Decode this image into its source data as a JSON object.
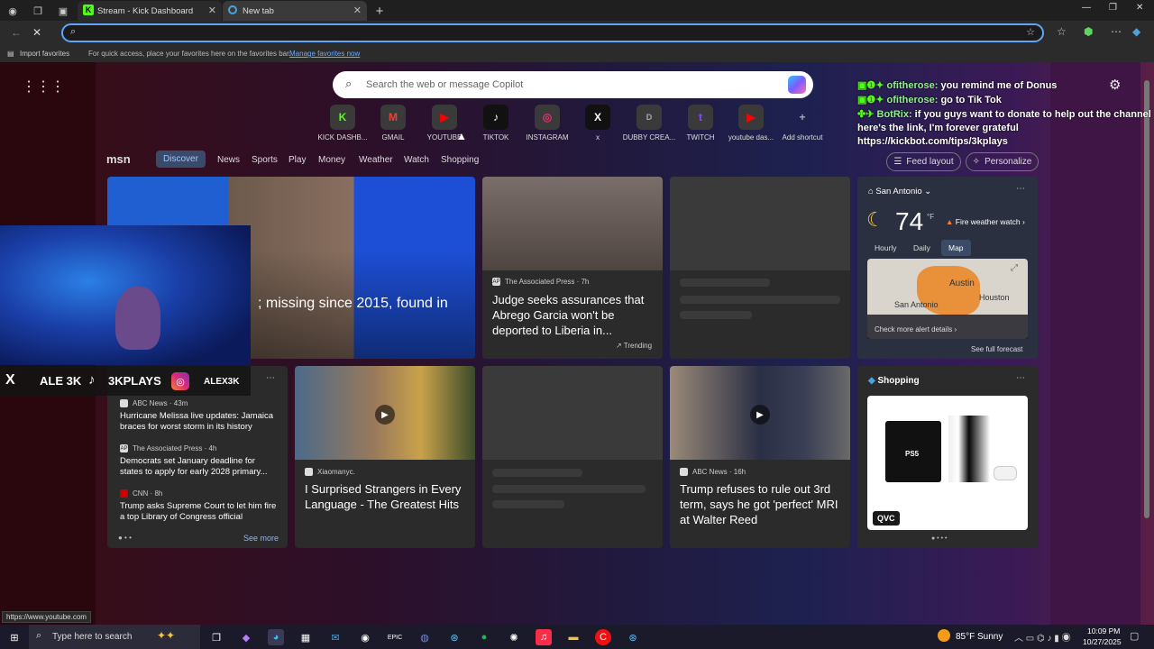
{
  "browser": {
    "tabs": [
      {
        "title": "Stream - Kick Dashboard",
        "favicon": "K"
      },
      {
        "title": "New tab"
      }
    ],
    "address_value": "",
    "favorites": {
      "import_label": "Import favorites",
      "hint": "For quick access, place your favorites here on the favorites bar.",
      "manage_link": "Manage favorites now"
    },
    "status_url": "https://www.youtube.com"
  },
  "newtab": {
    "search_placeholder": "Search the web or message Copilot",
    "shortcuts": [
      {
        "label": "KICK DASHB...",
        "glyph": "K",
        "color": "#53fc18"
      },
      {
        "label": "GMAIL",
        "glyph": "M",
        "color": "#ea4335"
      },
      {
        "label": "YOUTUBE",
        "glyph": "▶",
        "color": "#ff0000"
      },
      {
        "label": "TIKTOK",
        "glyph": "♪",
        "color": "#ffffff"
      },
      {
        "label": "INSTAGRAM",
        "glyph": "◎",
        "color": "#e1306c"
      },
      {
        "label": "x",
        "glyph": "X",
        "color": "#ffffff"
      },
      {
        "label": "DUBBY CREA...",
        "glyph": "D",
        "color": "#aaaaaa"
      },
      {
        "label": "TWITCH",
        "glyph": "t",
        "color": "#9146ff"
      },
      {
        "label": "youtube das...",
        "glyph": "▶",
        "color": "#ff0000"
      },
      {
        "label": "Add shortcut",
        "glyph": "+",
        "color": "#aaaaaa"
      }
    ],
    "msn": {
      "logo": "msn",
      "nav": [
        "Discover",
        "News",
        "Sports",
        "Play",
        "Money",
        "Weather",
        "Watch",
        "Shopping"
      ],
      "feed_layout": "Feed layout",
      "personalize": "Personalize"
    }
  },
  "cards": {
    "hero": {
      "headline": "; missing since 2015, found in"
    },
    "ap": {
      "source": "The Associated Press · 7h",
      "headline": "Judge seeks assurances that Abrego Garcia won't be deported to Liberia in...",
      "tag": "Trending"
    },
    "news_list": [
      {
        "source": "ABC News · 43m",
        "headline": "Hurricane Melissa live updates: Jamaica braces for worst storm in its history"
      },
      {
        "source": "The Associated Press · 4h",
        "headline": "Democrats set January deadline for states to apply for early 2028 primary..."
      },
      {
        "source": "CNN · 8h",
        "headline": "Trump asks Supreme Court to let him fire a top Library of Congress official"
      }
    ],
    "see_more": "See more",
    "video": {
      "source": "Xiaomanyc.",
      "headline": "I Surprised Strangers in Every Language - The Greatest Hits"
    },
    "trump": {
      "source": "ABC News · 16h",
      "headline": "Trump refuses to rule out 3rd term, says he got 'perfect' MRI at Walter Reed"
    }
  },
  "weather": {
    "location": "San Antonio",
    "temp": "74",
    "unit": "°F",
    "alert": "Fire weather watch",
    "tabs": [
      "Hourly",
      "Daily",
      "Map"
    ],
    "map_city1": "Austin",
    "map_city2": "Houston",
    "map_city3": "San Antonio",
    "alert_link": "Check more alert details",
    "forecast_link": "See full forecast"
  },
  "shopping": {
    "title": "Shopping",
    "badge": "QVC",
    "product": "PS5"
  },
  "stream_overlay": {
    "chat": [
      {
        "user": "ofitherose:",
        "message": "you remind me of Donus"
      },
      {
        "user": "ofitherose:",
        "message": "go to Tik Tok"
      },
      {
        "user": "BotRix:",
        "message": "if you guys want to donate to help out the channel here's the link, I'm forever grateful https://kickbot.com/tips/3kplays"
      }
    ],
    "socials": [
      "ALE 3K",
      "3KPLAYS",
      "ALEX3K"
    ]
  },
  "taskbar": {
    "search": "Type here to search",
    "weather": "85°F  Sunny",
    "time": "10:09 PM",
    "date": "10/27/2025"
  }
}
